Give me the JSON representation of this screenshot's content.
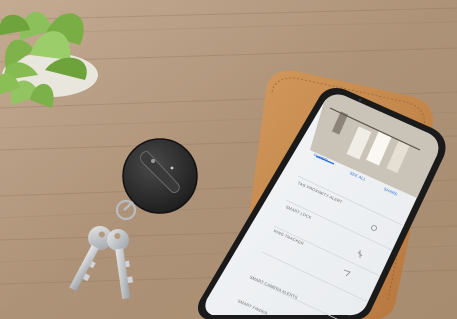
{
  "photo": {
    "description_subjects": [
      "succulent-plant",
      "wooden-table",
      "bluetooth-tracker-keyfob",
      "keys",
      "leather-phone-sleeve",
      "smartphone-app"
    ]
  },
  "phone_screen": {
    "tabs": [
      "FLOOR",
      "SEE ALL",
      "SHARE"
    ],
    "rows": [
      {
        "label": "TAG PROXIMITY ALERT"
      },
      {
        "label": "SMART LOCK"
      },
      {
        "label": "RING TRACKER"
      },
      {
        "label": ""
      },
      {
        "label": "SMART CAMERA ALERTS"
      },
      {
        "label": "SMART FINDER"
      }
    ],
    "accent": "#2a6fd6"
  },
  "colors": {
    "table": "#b59a7f",
    "leather": "#c88a4c",
    "tracker": "#2b2b2b",
    "phone_frame": "#1a1a1a"
  }
}
